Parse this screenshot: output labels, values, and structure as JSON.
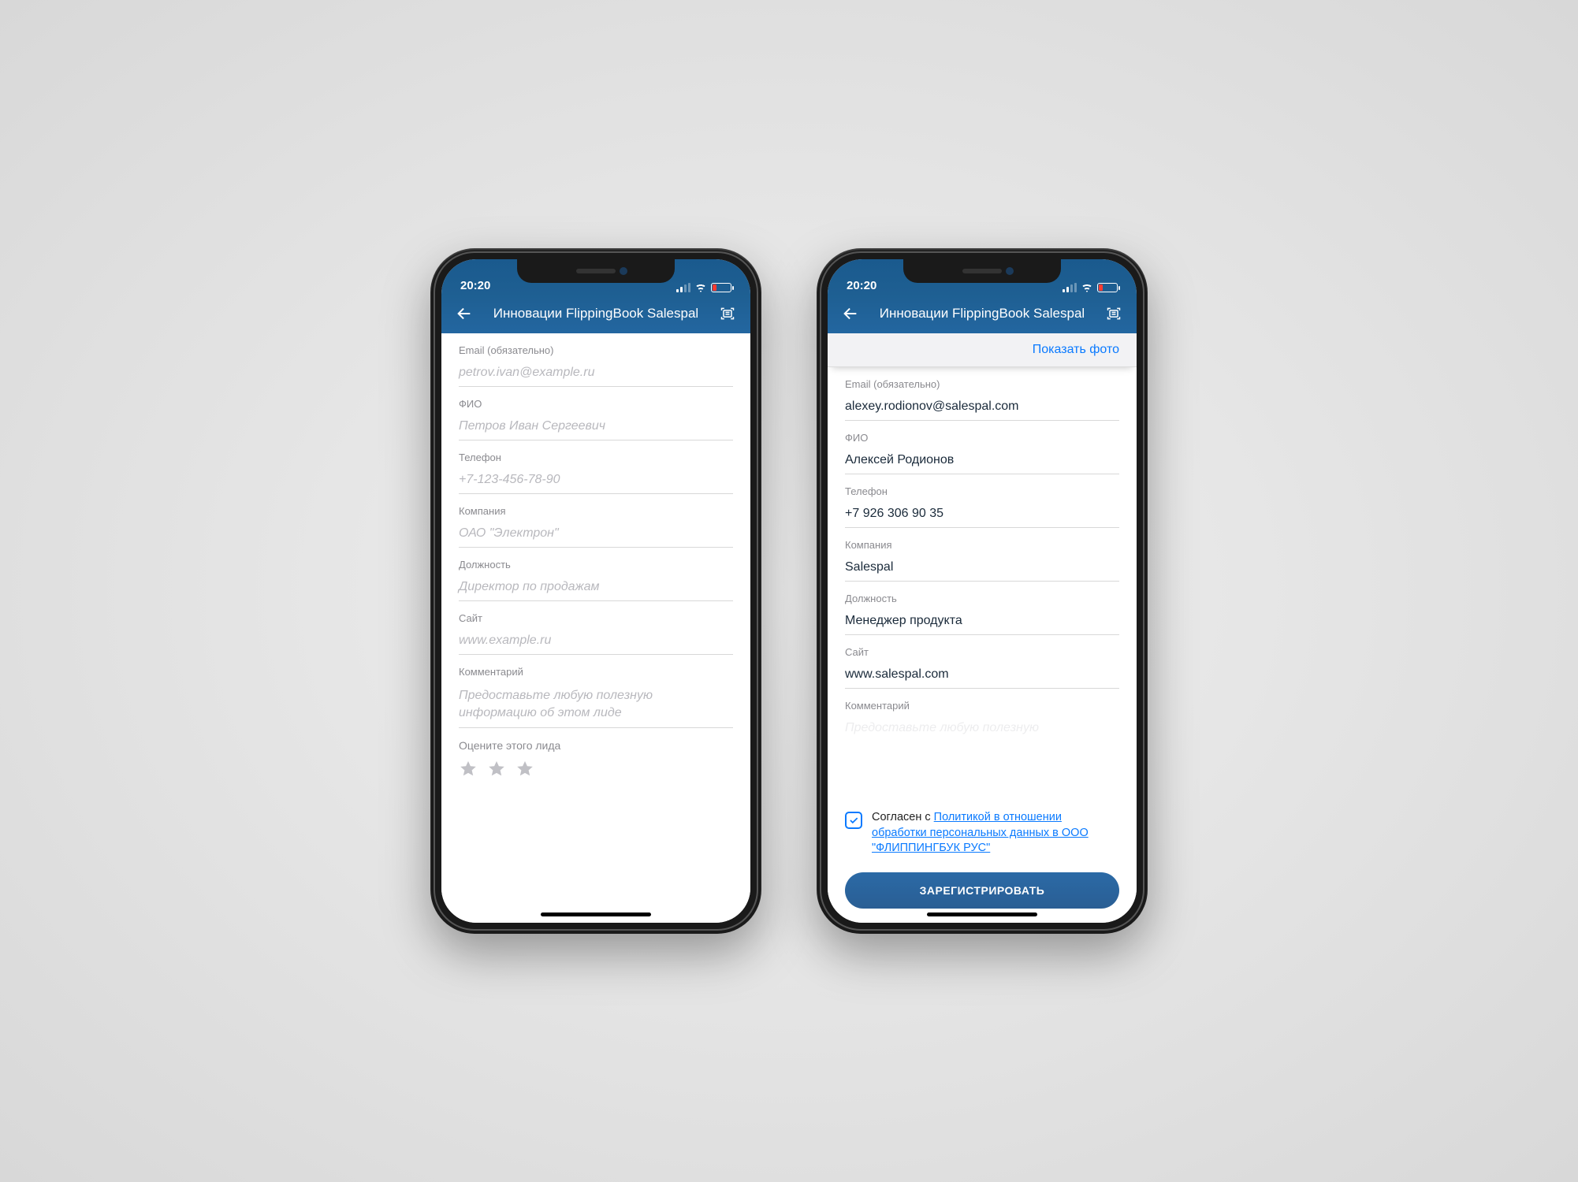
{
  "status": {
    "time": "20:20"
  },
  "header": {
    "title": "Инновации FlippingBook Salespal"
  },
  "left": {
    "email": {
      "label": "Email (обязательно)",
      "placeholder": "petrov.ivan@example.ru"
    },
    "name": {
      "label": "ФИО",
      "placeholder": "Петров Иван Сергеевич"
    },
    "phone": {
      "label": "Телефон",
      "placeholder": "+7-123-456-78-90"
    },
    "company": {
      "label": "Компания",
      "placeholder": "ОАО \"Электрон\""
    },
    "position": {
      "label": "Должность",
      "placeholder": "Директор по продажам"
    },
    "site": {
      "label": "Сайт",
      "placeholder": "www.example.ru"
    },
    "comment": {
      "label": "Комментарий",
      "placeholder": "Предоставьте любую полезную информацию об этом лиде"
    },
    "rating_label": "Оцените этого лида"
  },
  "right": {
    "photo_action": "Показать фото",
    "email": {
      "label": "Email (обязательно)",
      "value": "alexey.rodionov@salespal.com"
    },
    "name": {
      "label": "ФИО",
      "value": "Алексей Родионов"
    },
    "phone": {
      "label": "Телефон",
      "value": "+7 926 306 90 35"
    },
    "company": {
      "label": "Компания",
      "value": "Salespal"
    },
    "position": {
      "label": "Должность",
      "value": "Менеджер продукта"
    },
    "site": {
      "label": "Сайт",
      "value": "www.salespal.com"
    },
    "comment": {
      "label": "Комментарий"
    },
    "consent_prefix": "Согласен с ",
    "consent_link": "Политикой в отношении обработки персональных данных в ООО \"ФЛИППИНГБУК РУС\"",
    "register": "ЗАРЕГИСТРИРОВАТЬ"
  }
}
